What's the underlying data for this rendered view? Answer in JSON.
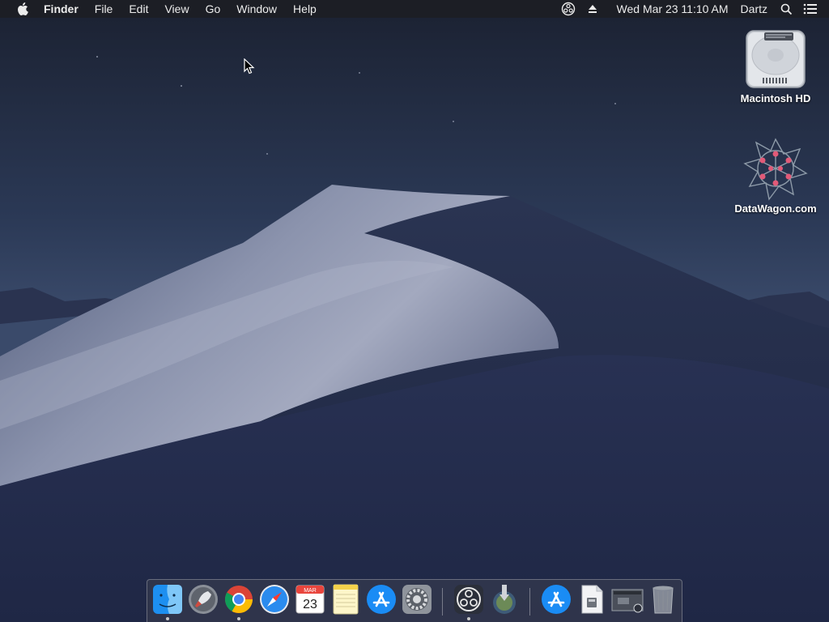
{
  "menubar": {
    "apple_icon": "apple-logo-icon",
    "app_name": "Finder",
    "items": [
      "File",
      "Edit",
      "View",
      "Go",
      "Window",
      "Help"
    ],
    "status_icons": [
      "obs-icon",
      "eject-icon"
    ],
    "clock": "Wed Mar 23  11:10 AM",
    "user": "Dartz",
    "right_icons": [
      "spotlight-search-icon",
      "notification-center-icon"
    ]
  },
  "desktop": {
    "icons": [
      {
        "label": "Macintosh HD",
        "icon": "hard-drive-icon"
      },
      {
        "label": "DataWagon.com",
        "icon": "datawagon-network-icon"
      }
    ]
  },
  "dock": {
    "apps": [
      {
        "name": "Finder",
        "icon": "finder-icon",
        "running": true
      },
      {
        "name": "Launchpad",
        "icon": "launchpad-icon",
        "running": false
      },
      {
        "name": "Chrome",
        "icon": "chrome-icon",
        "running": true
      },
      {
        "name": "Safari",
        "icon": "safari-icon",
        "running": false
      },
      {
        "name": "Calendar",
        "icon": "calendar-icon",
        "running": false,
        "month": "MAR",
        "day": "23"
      },
      {
        "name": "Notes",
        "icon": "notes-icon",
        "running": false
      },
      {
        "name": "App Store",
        "icon": "app-store-icon",
        "running": false
      },
      {
        "name": "System Preferences",
        "icon": "system-preferences-icon",
        "running": false
      },
      {
        "name": "OBS",
        "icon": "obs-icon",
        "running": true
      },
      {
        "name": "Installer",
        "icon": "installer-icon",
        "running": false
      },
      {
        "name": "App Store Folder",
        "icon": "app-store-icon",
        "running": false
      },
      {
        "name": "Document",
        "icon": "document-icon",
        "running": false
      },
      {
        "name": "Screenshot",
        "icon": "screenshot-thumbnail-icon",
        "running": false
      },
      {
        "name": "Trash",
        "icon": "trash-icon",
        "running": false
      }
    ]
  }
}
